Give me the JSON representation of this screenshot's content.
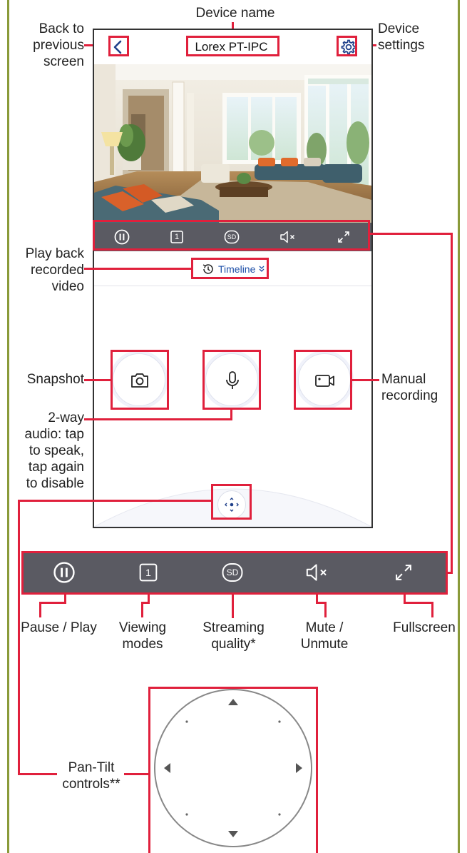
{
  "app": {
    "device_name": "Lorex PT-IPC",
    "timeline_label": "Timeline"
  },
  "callouts": {
    "device_name": "Device name",
    "back": "Back to previous screen",
    "back_lines": [
      "Back to",
      "previous",
      "screen"
    ],
    "settings_lines": [
      "Device",
      "settings"
    ],
    "playback_lines": [
      "Play back",
      "recorded",
      "video"
    ],
    "snapshot": "Snapshot",
    "manual_lines": [
      "Manual",
      "recording"
    ],
    "audio_lines": [
      "2-way",
      "audio: tap",
      "to speak,",
      "tap again",
      "to disable"
    ],
    "pause_play": "Pause / Play",
    "viewing_lines": [
      "Viewing",
      "modes"
    ],
    "streaming_lines": [
      "Streaming",
      "quality*"
    ],
    "mute_lines": [
      "Mute /",
      "Unmute"
    ],
    "fullscreen": "Fullscreen",
    "pantilt_lines": [
      "Pan-Tilt",
      "controls**"
    ]
  },
  "controls": {
    "viewing_mode_value": "1",
    "quality_value": "SD"
  },
  "icons": [
    "back-chevron-icon",
    "gear-icon",
    "pause-icon",
    "viewing-mode-icon",
    "sd-quality-icon",
    "mute-icon",
    "fullscreen-icon",
    "history-clock-icon",
    "camera-icon",
    "microphone-icon",
    "video-record-icon",
    "ptz-icon"
  ],
  "colors": {
    "highlight": "#e0203c",
    "control_bar": "#5a5a62",
    "link": "#1e4fa8",
    "frame_border": "#8a9a3a"
  }
}
